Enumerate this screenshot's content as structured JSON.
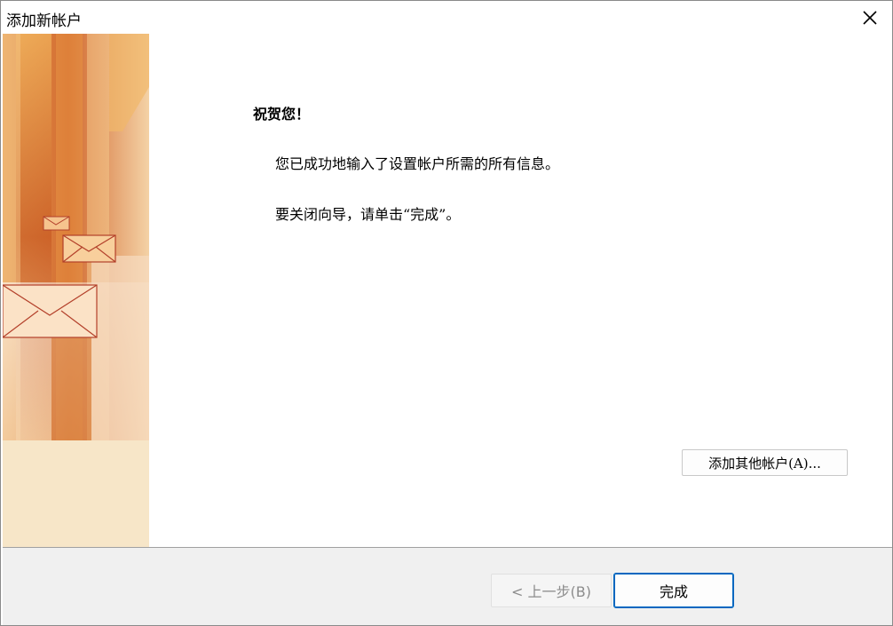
{
  "window": {
    "title": "添加新帐户"
  },
  "content": {
    "heading": "祝贺您！",
    "message_1": "您已成功地输入了设置帐户所需的所有信息。",
    "message_2": "要关闭向导，请单击“完成”。",
    "add_other_account_label": "添加其他帐户(A)..."
  },
  "footer": {
    "back_label": "< 上一步(B)",
    "finish_label": "完成",
    "back_enabled": false
  },
  "icons": {
    "close": "close-icon",
    "banner": "envelope-banner"
  },
  "colors": {
    "accent": "#0067c0",
    "banner_orange": "#e08a3c",
    "banner_light": "#f7e6c8"
  }
}
